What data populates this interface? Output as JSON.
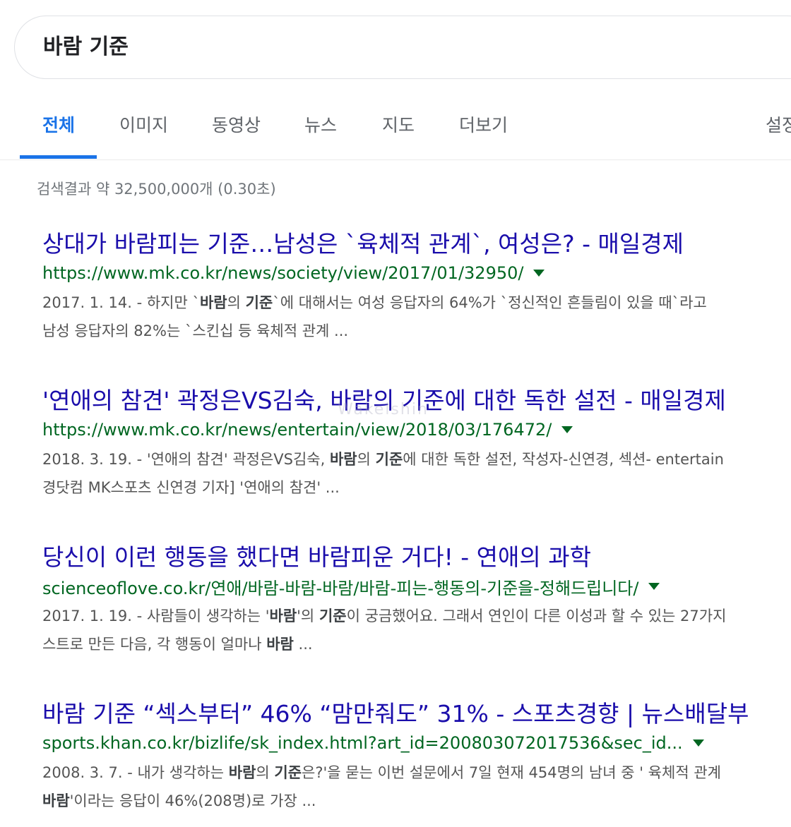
{
  "search": {
    "query": "바람 기준"
  },
  "tabs": [
    {
      "label": "전체",
      "active": true
    },
    {
      "label": "이미지",
      "active": false
    },
    {
      "label": "동영상",
      "active": false
    },
    {
      "label": "뉴스",
      "active": false
    },
    {
      "label": "지도",
      "active": false
    },
    {
      "label": "더보기",
      "active": false
    },
    {
      "label": "설정",
      "active": false
    }
  ],
  "stats": "검색결과 약 32,500,000개 (0.30초)",
  "watermark": "Wakelshin",
  "results": [
    {
      "title": "상대가 바람피는 기준…남성은 `육체적 관계`, 여성은? - 매일경제",
      "url": "https://www.mk.co.kr/news/society/view/2017/01/32950/",
      "snippet_line1": [
        {
          "t": "2017. 1. 14. - 하지만 `",
          "b": false
        },
        {
          "t": "바람",
          "b": true
        },
        {
          "t": "의 ",
          "b": false
        },
        {
          "t": "기준",
          "b": true
        },
        {
          "t": "`에 대해서는 여성 응답자의 64%가 `정신적인 흔들림이 있을 때`라고",
          "b": false
        }
      ],
      "snippet_line2": [
        {
          "t": "남성 응답자의 82%는 `스킨십 등 육체적 관계 ...",
          "b": false
        }
      ]
    },
    {
      "title": "'연애의 참견' 곽정은VS김숙, 바람의 기준에 대한 독한 설전 - 매일경제",
      "url": "https://www.mk.co.kr/news/entertain/view/2018/03/176472/",
      "snippet_line1": [
        {
          "t": "2018. 3. 19. - '연애의 참견' 곽정은VS김숙, ",
          "b": false
        },
        {
          "t": "바람",
          "b": true
        },
        {
          "t": "의 ",
          "b": false
        },
        {
          "t": "기준",
          "b": true
        },
        {
          "t": "에 대한 독한 설전, 작성자-신연경, 섹션- entertain",
          "b": false
        }
      ],
      "snippet_line2": [
        {
          "t": "경닷컴 MK스포츠 신연경 기자] '연애의 참견' ...",
          "b": false
        }
      ]
    },
    {
      "title": "당신이 이런 행동을 했다면 바람피운 거다! - 연애의 과학",
      "url": "scienceoflove.co.kr/연애/바람-바람-바람/바람-피는-행동의-기준을-정해드립니다/",
      "snippet_line1": [
        {
          "t": "2017. 1. 19. - 사람들이 생각하는 '",
          "b": false
        },
        {
          "t": "바람",
          "b": true
        },
        {
          "t": "'의 ",
          "b": false
        },
        {
          "t": "기준",
          "b": true
        },
        {
          "t": "이 궁금했어요. 그래서 연인이 다른 이성과 할 수 있는 27가지",
          "b": false
        }
      ],
      "snippet_line2": [
        {
          "t": "스트로 만든 다음, 각 행동이 얼마나 ",
          "b": false
        },
        {
          "t": "바람",
          "b": true
        },
        {
          "t": " ...",
          "b": false
        }
      ]
    },
    {
      "title": "바람 기준 “섹스부터” 46% “맘만줘도” 31% - 스포츠경향 | 뉴스배달부",
      "url": "sports.khan.co.kr/bizlife/sk_index.html?art_id=200803072017536&sec_id...",
      "snippet_line1": [
        {
          "t": "2008. 3. 7. - 내가 생각하는 ",
          "b": false
        },
        {
          "t": "바람",
          "b": true
        },
        {
          "t": "의 ",
          "b": false
        },
        {
          "t": "기준",
          "b": true
        },
        {
          "t": "은?'을 묻는 이번 설문에서 7일 현재 454명의 남녀 중 ' 육체적 관계",
          "b": false
        }
      ],
      "snippet_line2": [
        {
          "t": "바람",
          "b": true
        },
        {
          "t": "'이라는 응답이 46%(208명)로 가장 ...",
          "b": false
        }
      ]
    }
  ]
}
